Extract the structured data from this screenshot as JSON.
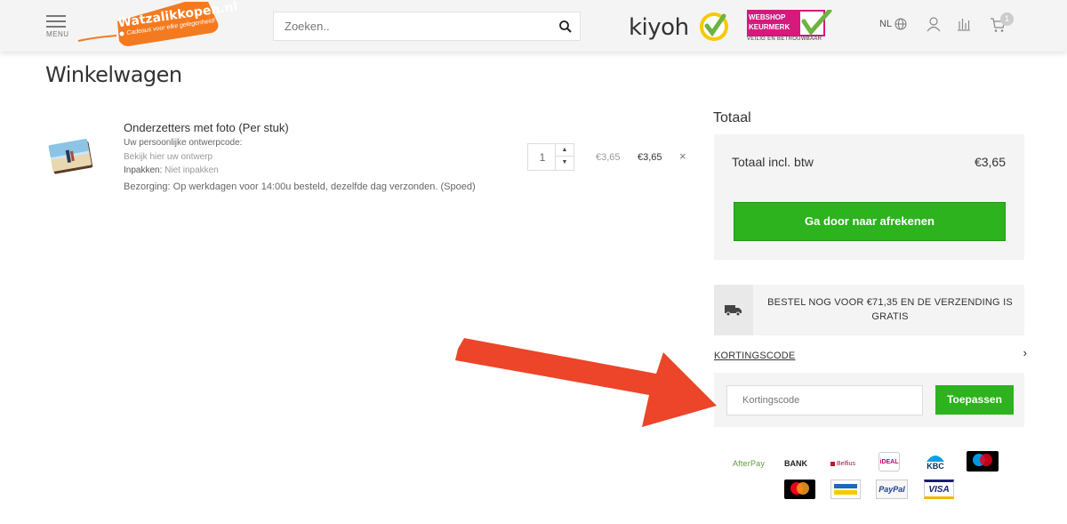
{
  "header": {
    "menu_label": "MENU",
    "logo_text": "Watzalikkopen.nl",
    "logo_tagline": "Cadeaus voor elke gelegenheid!",
    "search_placeholder": "Zoeken..",
    "kiyoh_text": "kiyoh",
    "keurmerk_line1": "WEBSHOP",
    "keurmerk_line2": "KEURMERK",
    "keurmerk_sub": "VEILIG EN BETROUWBAAR",
    "language": "NL",
    "cart_count": "1",
    "colors": {
      "brand_orange": "#f47a20",
      "header_bg": "#f4f4f4"
    }
  },
  "page": {
    "title": "Winkelwagen"
  },
  "cart": {
    "items": [
      {
        "name": "Onderzetters met foto (Per stuk)",
        "design_label": "Uw persoonlijke ontwerpcode:",
        "design_link": "Bekijk hier uw ontwerp",
        "packing_label": "Inpakken:",
        "packing_value": "Niet inpakken",
        "delivery": "Bezorging: Op werkdagen voor 14:00u besteld, dezelfde dag verzonden. (Spoed)",
        "quantity": "1",
        "unit_price": "€3,65",
        "total": "€3,65",
        "remove_symbol": "×"
      }
    ]
  },
  "summary": {
    "heading": "Totaal",
    "total_label": "Totaal incl. btw",
    "total_value": "€3,65",
    "checkout_button": "Ga door naar afrekenen",
    "colors": {
      "button_green": "#2cb31d"
    }
  },
  "shipping": {
    "icon": "truck-icon",
    "message": "BESTEL NOG VOOR €71,35 EN DE VERZENDING IS GRATIS"
  },
  "discount": {
    "toggle_label": "KORTINGSCODE",
    "input_placeholder": "Kortingscode",
    "apply_button": "Toepassen"
  },
  "payment_methods": {
    "afterpay": "AfterPay",
    "bank": "BANK",
    "belfius": "Belfius",
    "ideal": "iDEAL",
    "kbc": "KBC",
    "maestro": "maestro",
    "mastercard": "mastercard",
    "bancontact": "Bancontact Mister Cash",
    "paypal": "PayPal",
    "visa": "VISA"
  },
  "annotation": {
    "arrow_color": "#ec4529"
  }
}
